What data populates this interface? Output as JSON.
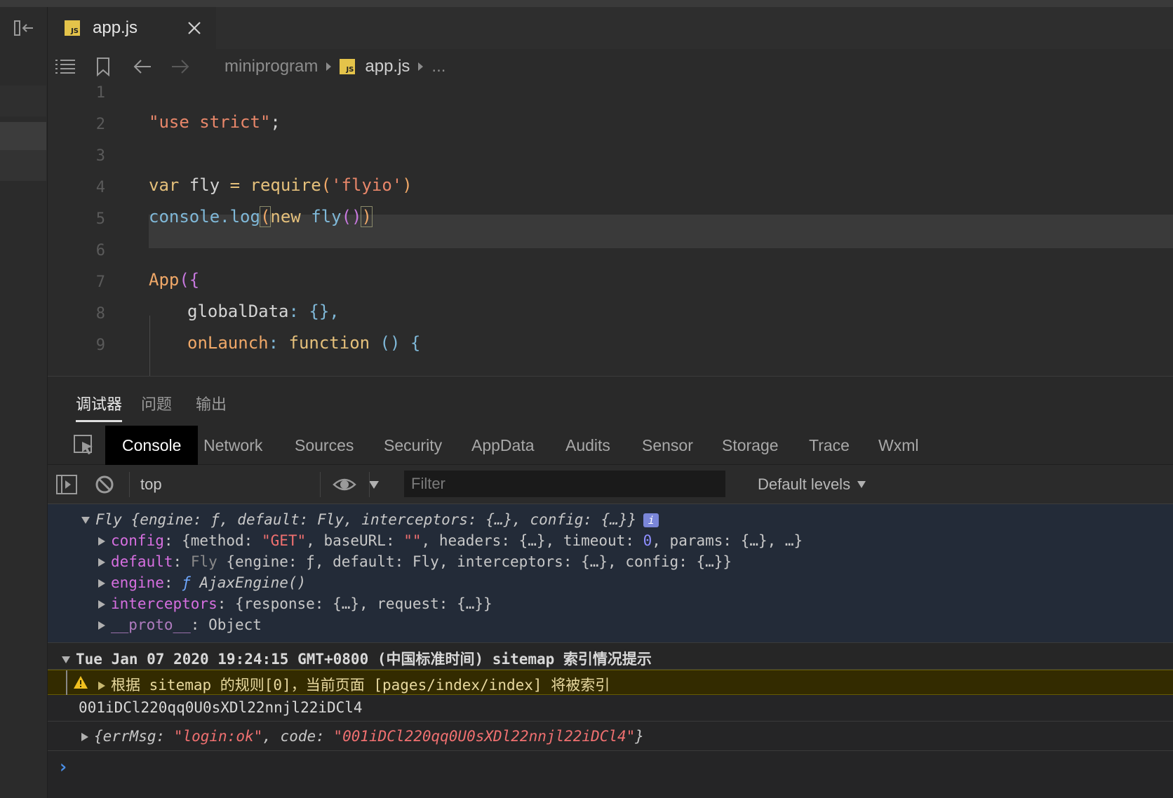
{
  "tab": {
    "title": "app.js",
    "badge": "JS"
  },
  "breadcrumb": {
    "folder": "miniprogram",
    "file": "app.js",
    "more": "..."
  },
  "editor": {
    "lines": [
      {
        "n": "1"
      },
      {
        "n": "2"
      },
      {
        "n": "3"
      },
      {
        "n": "4"
      },
      {
        "n": "5"
      },
      {
        "n": "6"
      },
      {
        "n": "7"
      },
      {
        "n": "8"
      },
      {
        "n": "9"
      }
    ],
    "code": {
      "l2_str": "\"use strict\"",
      "l2_semi": ";",
      "l4_var": "var",
      "l4_name": " fly ",
      "l4_eq": "=",
      "l4_req": " require",
      "l4_open": "(",
      "l4_arg": "'flyio'",
      "l4_close": ")",
      "l5_console": "console.",
      "l5_log": "log",
      "l5_open": "(",
      "l5_new": "new",
      "l5_fly": " fly",
      "l5_paren": "()",
      "l5_close": ")",
      "l7_app": "App",
      "l7_brace": "({",
      "l8_key": "globalData",
      "l8_rest": ": {},",
      "l9_key": "onLaunch",
      "l9_colon": ": ",
      "l9_fn": "function",
      "l9_rest": " () {"
    }
  },
  "panel_tabs": [
    "调试器",
    "问题",
    "输出"
  ],
  "devtools_tabs": [
    "Console",
    "Network",
    "Sources",
    "Security",
    "AppData",
    "Audits",
    "Sensor",
    "Storage",
    "Trace",
    "Wxml"
  ],
  "toolbar": {
    "context": "top",
    "filter_placeholder": "Filter",
    "levels": "Default levels"
  },
  "console": {
    "obj_head": {
      "name": "Fly ",
      "body": "{engine: ƒ, default: Fly, interceptors: {…}, config: {…}}",
      "info": "i"
    },
    "props": [
      {
        "key": "config",
        "pre": ": {method: ",
        "s1": "\"GET\"",
        "mid": ", baseURL: ",
        "s2": "\"\"",
        "mid2": ", headers: {…}, timeout: ",
        "num": "0",
        "post": ", params: {…}, …}"
      },
      {
        "key": "default",
        "pre": ": ",
        "dimtxt": "Fly",
        "post": " {engine: ƒ, default: Fly, interceptors: {…}, config: {…}}"
      },
      {
        "key": "engine",
        "pre": ": ",
        "fsym": "ƒ",
        "post": " AjaxEngine()"
      },
      {
        "key": "interceptors",
        "post": ": {response: {…}, request: {…}}"
      },
      {
        "key": "__proto__",
        "post": ": Object"
      }
    ],
    "group_head": "Tue Jan 07 2020 19:24:15 GMT+0800 (中国标准时间) sitemap 索引情况提示",
    "warning": "根据 sitemap 的规则[0]，当前页面 [pages/index/index] 将被索引",
    "code_value": "001iDCl220qq0U0sXDl22nnjl22iDCl4",
    "result": {
      "open": "{",
      "k1": "errMsg",
      "v1": "\"login:ok\"",
      "sep": ", ",
      "k2": "code",
      "v2": "\"001iDCl220qq0U0sXDl22nnjl22iDCl4\"",
      "close": "}"
    },
    "prompt": "›"
  },
  "colors": {
    "accent_js": "#e4c34a",
    "warn_bg": "#332b00",
    "string": "#e9876a"
  }
}
